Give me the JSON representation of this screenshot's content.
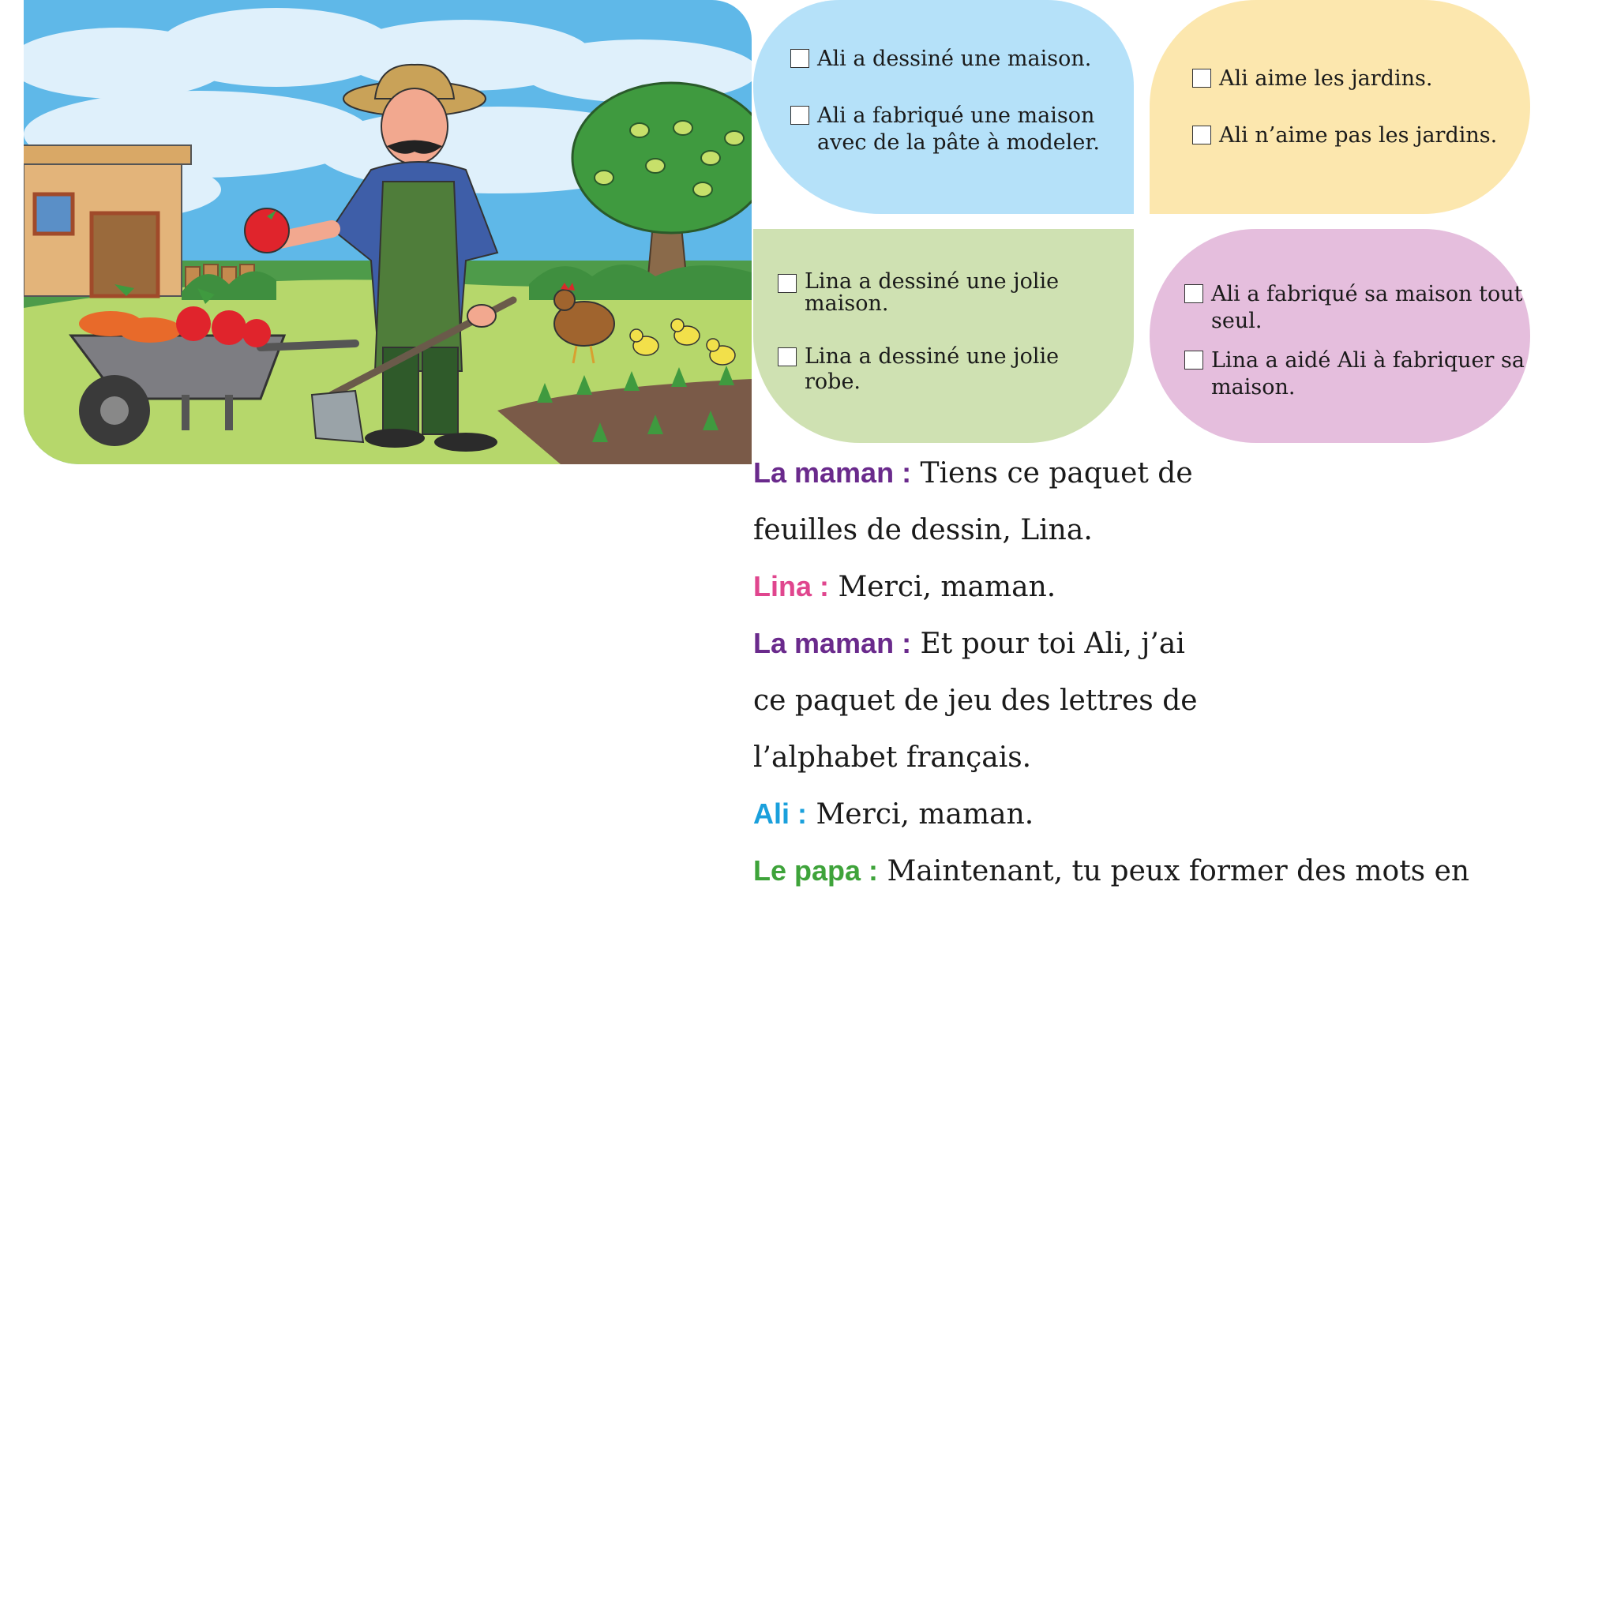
{
  "colors": {
    "bubble_blue": "#b5e1f9",
    "bubble_yellow": "#fce7ae",
    "bubble_green": "#cfe1b2",
    "bubble_pink": "#e5bedd",
    "speaker_maman": "#6a2a8c",
    "speaker_lina": "#e0468e",
    "speaker_ali": "#1aa0dc",
    "speaker_papa": "#3ea33a"
  },
  "illustration": {
    "icons": [
      "farmer-icon",
      "tomato-icon",
      "wheelbarrow-icon",
      "house-icon",
      "tree-icon",
      "hen-icon",
      "chick-icon",
      "hoe-icon"
    ]
  },
  "quiz": {
    "blue": [
      "Ali a dessiné une maison.",
      "Ali a fabriqué une maison\navec de la pâte à modeler."
    ],
    "yellow": [
      "Ali aime les jardins.",
      "Ali n’aime pas les jardins."
    ],
    "green": [
      "Lina a dessiné une jolie\nmaison.",
      "Lina a dessiné une jolie\nrobe."
    ],
    "pink": [
      "Ali a fabriqué sa maison tout\nseul.",
      "Lina a aidé Ali à fabriquer sa\nmaison."
    ]
  },
  "dialogue": [
    {
      "speaker": "La maman :",
      "text": " Tiens ce paquet de"
    },
    {
      "speaker": "",
      "text": "feuilles de dessin, Lina."
    },
    {
      "speaker": "Lina :",
      "text": " Merci, maman."
    },
    {
      "speaker": "La maman :",
      "text": " Et pour toi Ali, j’ai"
    },
    {
      "speaker": "",
      "text": "ce paquet de jeu des lettres de"
    },
    {
      "speaker": "",
      "text": "l’alphabet français."
    },
    {
      "speaker": "Ali :",
      "text": " Merci, maman."
    },
    {
      "speaker": "Le papa :",
      "text": " Maintenant, tu peux former des mots en"
    }
  ]
}
